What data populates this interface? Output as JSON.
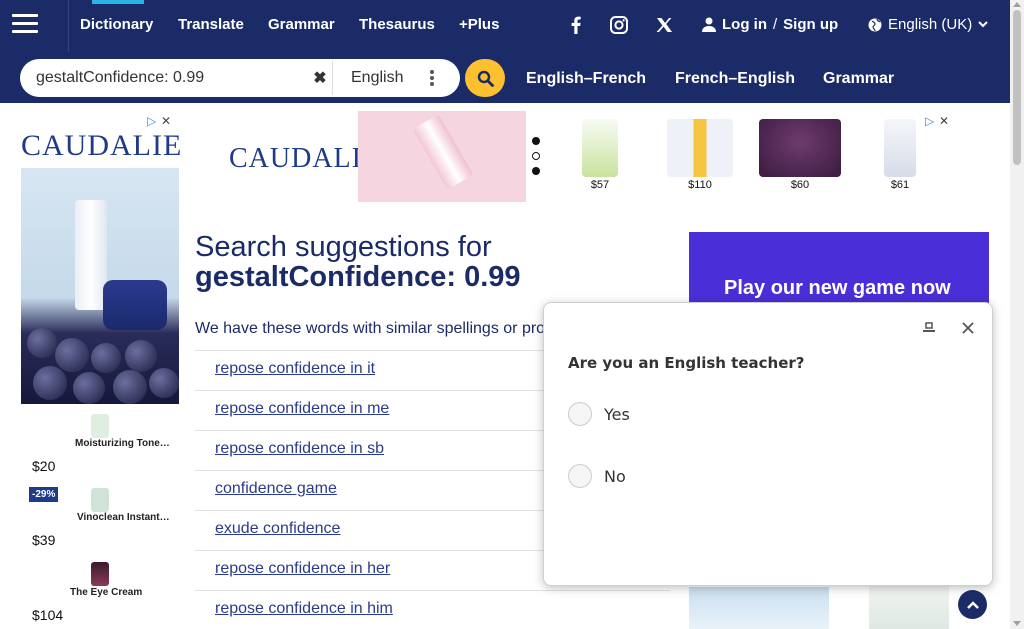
{
  "nav": {
    "items": [
      "Dictionary",
      "Translate",
      "Grammar",
      "Thesaurus",
      "+Plus"
    ],
    "login": "Log in",
    "separator": "/",
    "signup": "Sign up",
    "language": "English (UK)",
    "icons": [
      "menu-icon",
      "facebook-icon",
      "instagram-icon",
      "x-icon",
      "user-icon",
      "globe-icon",
      "chevron-down-icon"
    ]
  },
  "search": {
    "value": "gestaltConfidence: 0.99",
    "dictionary": "English",
    "links": [
      "English–French",
      "French–English",
      "Grammar"
    ]
  },
  "leftad": {
    "brand": "CAUDALIE",
    "products": [
      {
        "name": "Moisturizing Tone…",
        "price": "$20"
      },
      {
        "name": "Vinoclean Instant…",
        "price": "$39",
        "discount": "-29%"
      },
      {
        "name": "The Eye Cream",
        "price": "$104"
      }
    ]
  },
  "topad": {
    "brand": "CAUDALIE",
    "prices": [
      "$57",
      "$110",
      "$60",
      "$61"
    ]
  },
  "main": {
    "title": "Search suggestions for",
    "query": "gestaltConfidence: 0.99",
    "intro": "We have these words with similar spellings or pronunciations:",
    "suggestions": [
      "repose confidence in it",
      "repose confidence in me",
      "repose confidence in sb",
      "confidence game",
      "exude confidence",
      "repose confidence in her",
      "repose confidence in him"
    ]
  },
  "rightad": {
    "banner": "Play our new game now"
  },
  "survey": {
    "question": "Are you an English teacher?",
    "options": [
      "Yes",
      "No"
    ]
  },
  "colors": {
    "navy": "#1b2b68",
    "accent": "#fdc02f",
    "link": "#2a3b8f",
    "active": "#2bb3e6"
  }
}
